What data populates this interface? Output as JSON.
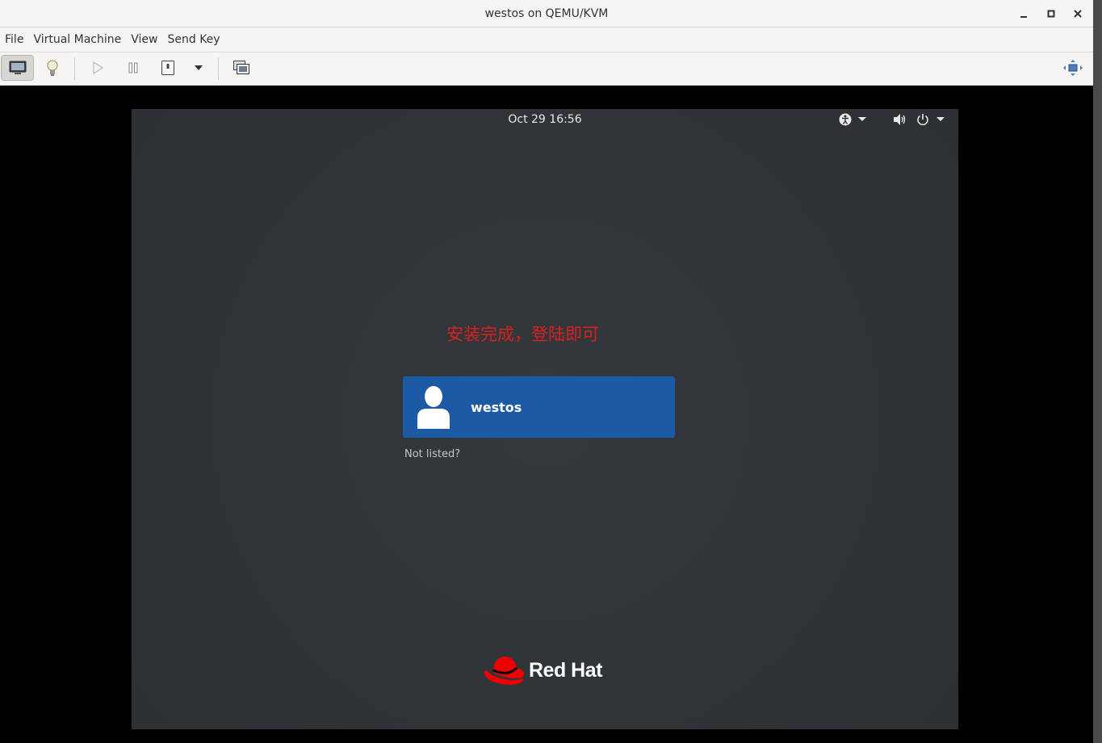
{
  "window": {
    "title": "westos on QEMU/KVM"
  },
  "menubar": {
    "items": [
      "File",
      "Virtual Machine",
      "View",
      "Send Key"
    ]
  },
  "toolbar": {
    "buttons": [
      "console-icon",
      "lightbulb-icon",
      "run-icon",
      "pause-icon",
      "shutdown-icon",
      "dropdown-icon",
      "snapshot-icon",
      "resize-icon"
    ]
  },
  "guest": {
    "clock": "Oct 29  16:56",
    "annotation": "安装完成，登陆即可",
    "user": {
      "name": "westos"
    },
    "not_listed": "Not listed?",
    "brand": "Red Hat"
  },
  "colors": {
    "user_card": "#1c5aa6",
    "annotation": "#d92020",
    "guest_bg": "#2f3337",
    "brand_red": "#ee0000"
  }
}
